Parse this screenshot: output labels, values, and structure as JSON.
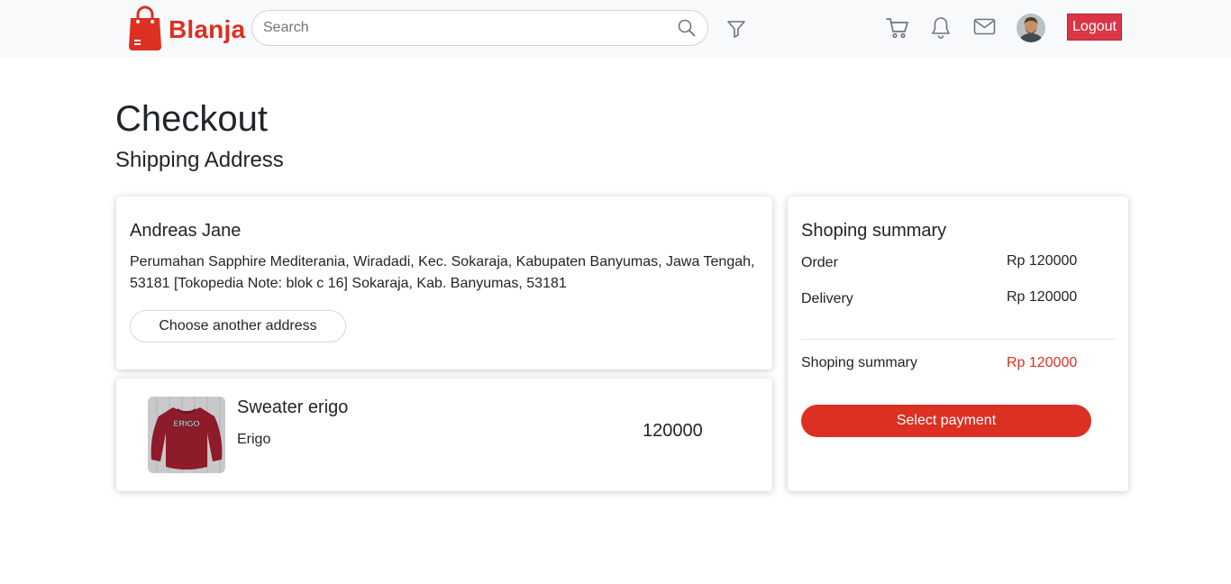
{
  "brand": {
    "name": "Blanja",
    "color": "#db3022"
  },
  "navbar": {
    "search_placeholder": "Search",
    "search_value": "",
    "icons": [
      "search-icon",
      "filter-icon",
      "cart-icon",
      "bell-icon",
      "mail-icon"
    ],
    "logout_label": "Logout"
  },
  "page": {
    "title": "Checkout",
    "section_title": "Shipping Address"
  },
  "address": {
    "name": "Andreas Jane",
    "text": "Perumahan Sapphire Mediterania, Wiradadi, Kec. Sokaraja, Kabupaten Banyumas, Jawa Tengah, 53181 [Tokopedia Note: blok c 16] Sokaraja, Kab. Banyumas, 53181",
    "choose_label": "Choose another address"
  },
  "product": {
    "name": "Sweater erigo",
    "brand": "Erigo",
    "price": "120000",
    "image_text": "ERIGO"
  },
  "summary": {
    "title": "Shoping summary",
    "order_label": "Order",
    "order_value": "Rp 120000",
    "delivery_label": "Delivery",
    "delivery_value": "Rp 120000",
    "total_label": "Shoping summary",
    "total_value": "Rp 120000",
    "pay_label": "Select payment"
  },
  "colors": {
    "accent": "#db3022",
    "logout": "#dc3545",
    "navbar_bg": "#f8f9fa"
  }
}
